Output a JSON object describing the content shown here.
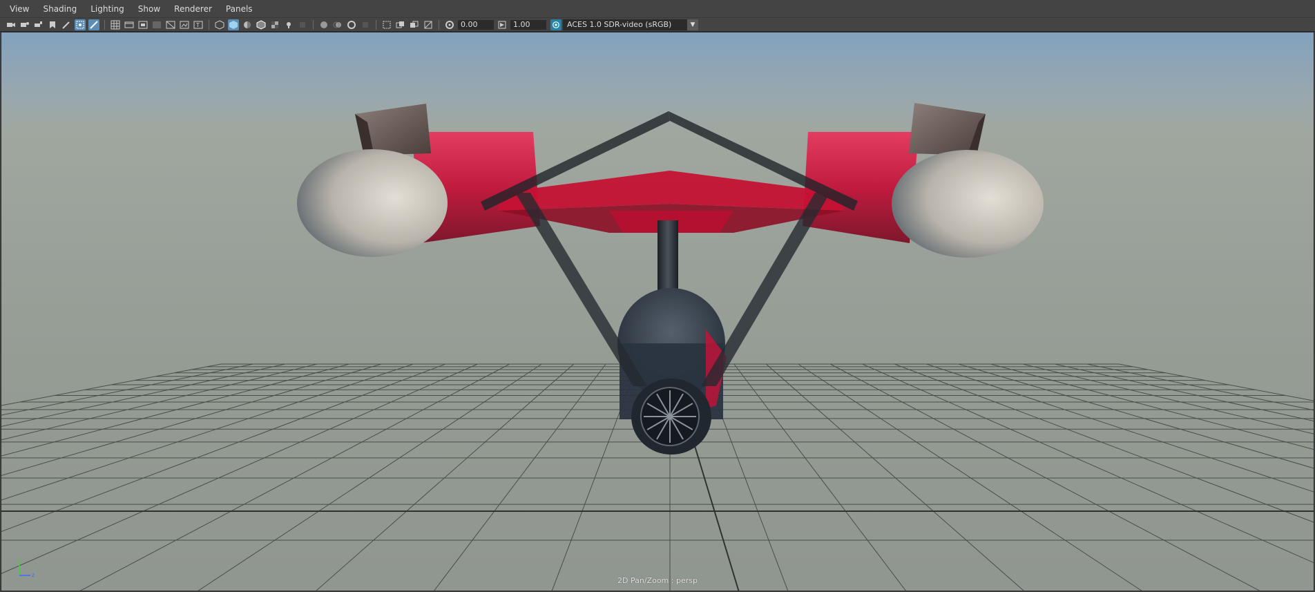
{
  "menu": {
    "items": [
      "View",
      "Shading",
      "Lighting",
      "Show",
      "Renderer",
      "Panels"
    ]
  },
  "toolbar": {
    "exposure_value": "0.00",
    "gamma_value": "1.00",
    "color_management": {
      "selected": "ACES 1.0 SDR-video (sRGB)"
    }
  },
  "viewport": {
    "camera_label": "2D Pan/Zoom : persp",
    "axis": {
      "y": "y",
      "z": "z"
    }
  },
  "colors": {
    "accent": "#5b8db5",
    "sky_top": "#83a2bd",
    "ground": "#959c94",
    "hull_red": "#d4123a"
  }
}
